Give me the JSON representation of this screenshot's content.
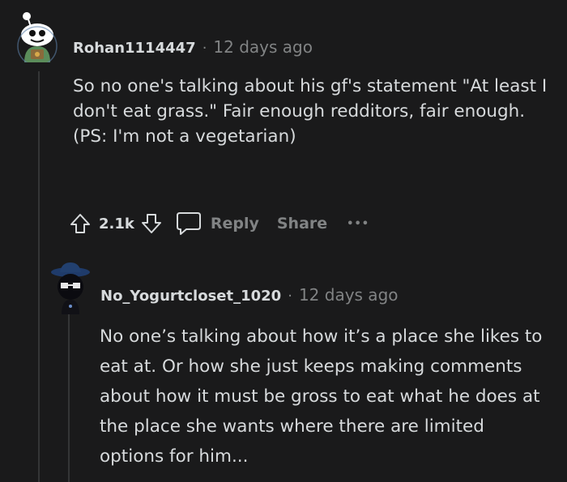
{
  "comments": [
    {
      "username": "Rohan1114447",
      "time": "12 days ago",
      "body": [
        "So no one's talking about his gf's statement \"At least I don't eat grass.\" Fair enough redditors, fair enough.",
        "(PS: I'm not a vegetarian)"
      ],
      "score": "2.1k",
      "reply_label": "Reply",
      "share_label": "Share",
      "more_label": "•••"
    },
    {
      "username": "No_Yogurtcloset_1020",
      "time": "12 days ago",
      "body": [
        "No one’s talking about how it’s a place she likes to eat at. Or how she just keeps making comments about how it must be gross to eat what he does at the place she wants where there are limited options for him..."
      ]
    }
  ],
  "separator": "·",
  "colors": {
    "background": "#1a1a1b",
    "text": "#d7dadc",
    "muted": "#818384",
    "thread_line": "#343536"
  }
}
